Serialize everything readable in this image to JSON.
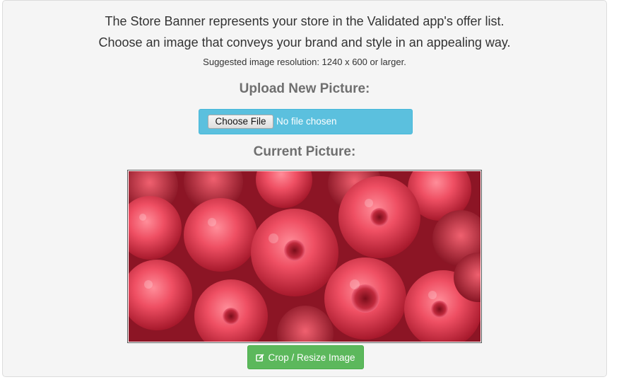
{
  "intro": {
    "line1": "The Store Banner represents your store in the Validated app's offer list.",
    "line2": "Choose an image that conveys your brand and style in an appealing way.",
    "hint": "Suggested image resolution: 1240 x 600 or larger."
  },
  "upload": {
    "heading": "Upload New Picture:",
    "choose_label": "Choose File",
    "status": "No file chosen"
  },
  "current": {
    "heading": "Current Picture:",
    "image_icon": "raspberries-photo"
  },
  "crop": {
    "label": "Crop / Resize Image",
    "icon": "edit-icon"
  },
  "colors": {
    "info_accent": "#5bc0de",
    "success_accent": "#5cb85c",
    "heading_gray": "#6f6f6f"
  }
}
